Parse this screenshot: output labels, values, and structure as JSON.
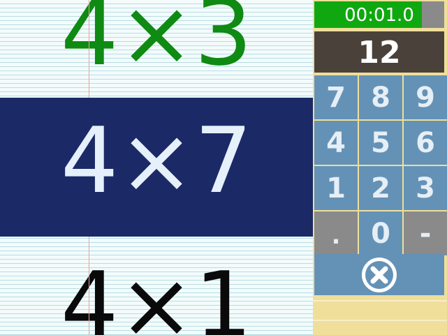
{
  "problems": {
    "previous": "4×3",
    "current": "4×7",
    "next": "4×1"
  },
  "timer": {
    "text": "00:01.0",
    "progress_percent": 83
  },
  "answer": {
    "value": "12"
  },
  "keypad": {
    "keys": [
      "7",
      "8",
      "9",
      "4",
      "5",
      "6",
      "1",
      "2",
      "3",
      ".",
      "0",
      "-"
    ]
  },
  "icons": {
    "clear": "close-circle-icon"
  },
  "colors": {
    "previous_problem": "#0f8a12",
    "current_band": "#1b2a66",
    "timer_fill": "#10a810",
    "key_blue": "#6492b7",
    "key_gray": "#8a8a8a",
    "display_bg": "#4a423a"
  }
}
